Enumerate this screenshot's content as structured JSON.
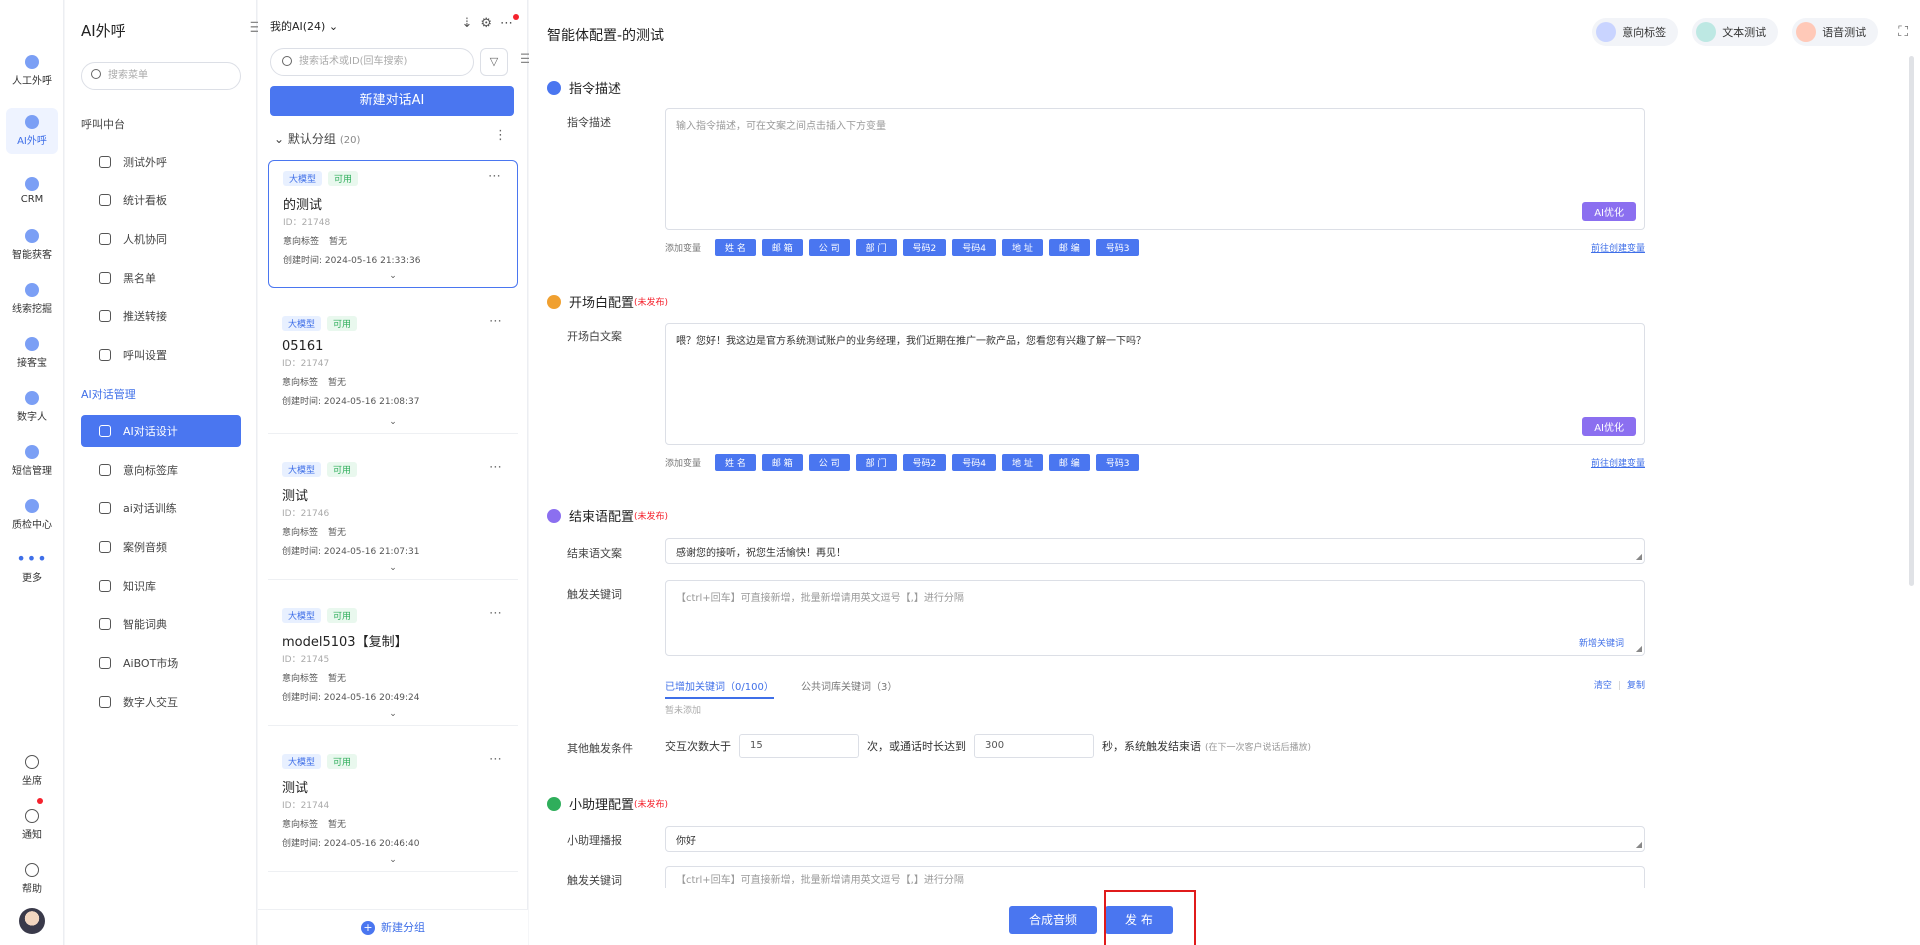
{
  "rail": {
    "items": [
      "人工外呼",
      "AI外呼",
      "CRM",
      "智能获客",
      "线索挖掘",
      "接客宝",
      "数字人",
      "短信管理",
      "质检中心",
      "更多"
    ],
    "bottom": [
      "坐席",
      "通知",
      "帮助"
    ]
  },
  "menu": {
    "title": "AI外呼",
    "search_placeholder": "搜索菜单",
    "group1": "呼叫中台",
    "group1_items": [
      "测试外呼",
      "统计看板",
      "人机协同",
      "黑名单",
      "推送转接",
      "呼叫设置"
    ],
    "group2": "AI对话管理",
    "group2_items": [
      "AI对话设计",
      "意向标签库",
      "ai对话训练",
      "案例音频",
      "知识库",
      "智能词典",
      "AiBOT市场",
      "数字人交互"
    ]
  },
  "list": {
    "header": "我的AI(24)",
    "search_placeholder": "搜索话术或ID(回车搜索)",
    "new_button": "新建对话AI",
    "group_name": "默认分组",
    "group_count": "(20)",
    "tag_model": "大模型",
    "tag_available": "可用",
    "intent_label": "意向标签",
    "intent_value": "暂无",
    "created_label": "创建时间:",
    "cards": [
      {
        "name": "的测试",
        "id": "ID：21748",
        "time": "2024-05-16 21:33:36"
      },
      {
        "name": "05161",
        "id": "ID：21747",
        "time": "2024-05-16 21:08:37"
      },
      {
        "name": "测试",
        "id": "ID：21746",
        "time": "2024-05-16 21:07:31"
      },
      {
        "name": "model5103【复制】",
        "id": "ID：21745",
        "time": "2024-05-16 20:49:24"
      },
      {
        "name": "测试",
        "id": "ID：21744",
        "time": "2024-05-16 20:46:40"
      }
    ],
    "new_group": "新建分组"
  },
  "main": {
    "title": "智能体配置-的测试",
    "actions": [
      "意向标签",
      "文本测试",
      "语音测试"
    ],
    "s1": {
      "title": "指令描述",
      "label": "指令描述",
      "placeholder": "输入指令描述，可在文案之间点击插入下方变量",
      "ai_button": "AI优化"
    },
    "vars_label": "添加变量",
    "vars": [
      "姓 名",
      "邮 箱",
      "公 司",
      "部 门",
      "号码2",
      "号码4",
      "地 址",
      "邮 编",
      "号码3"
    ],
    "vars_link": "前往创建变量",
    "s2": {
      "title": "开场白配置",
      "unpublished": "(未发布)",
      "label": "开场白文案",
      "value": "喂？您好！我这边是官方系统测试账户的业务经理，我们近期在推广一款产品，您看您有兴趣了解一下吗？",
      "ai_button": "AI优化"
    },
    "s3": {
      "title": "结束语配置",
      "unpublished": "(未发布)",
      "label": "结束语文案",
      "value": "感谢您的接听，祝您生活愉快！再见！",
      "kw_label": "触发关键词",
      "kw_placeholder": "【ctrl+回车】可直接新增，批量新增请用英文逗号【,】进行分隔",
      "kw_new": "新增关键词",
      "tab_added": "已增加关键词（0/100）",
      "tab_public": "公共词库关键词（3）",
      "clear": "清空",
      "copy": "复制",
      "none": "暂未添加",
      "other_label": "其他触发条件",
      "cond_prefix": "交互次数大于",
      "cond_value1": "15",
      "cond_middle": "次，或通话时长达到",
      "cond_value2": "300",
      "cond_suffix": "秒，系统触发结束语",
      "cond_hint": "(在下一次客户说话后播放)"
    },
    "s4": {
      "title": "小助理配置",
      "unpublished": "(未发布)",
      "label": "小助理播报",
      "value": "你好",
      "kw_label": "触发关键词",
      "kw_placeholder": "【ctrl+回车】可直接新增，批量新增请用英文逗号【,】进行分隔"
    },
    "btn_synth": "合成音频",
    "btn_publish": "发 布"
  },
  "colors": {
    "primary": "#4a76f0",
    "accent_purple": "#8b6ff0",
    "danger": "#f5222d"
  }
}
